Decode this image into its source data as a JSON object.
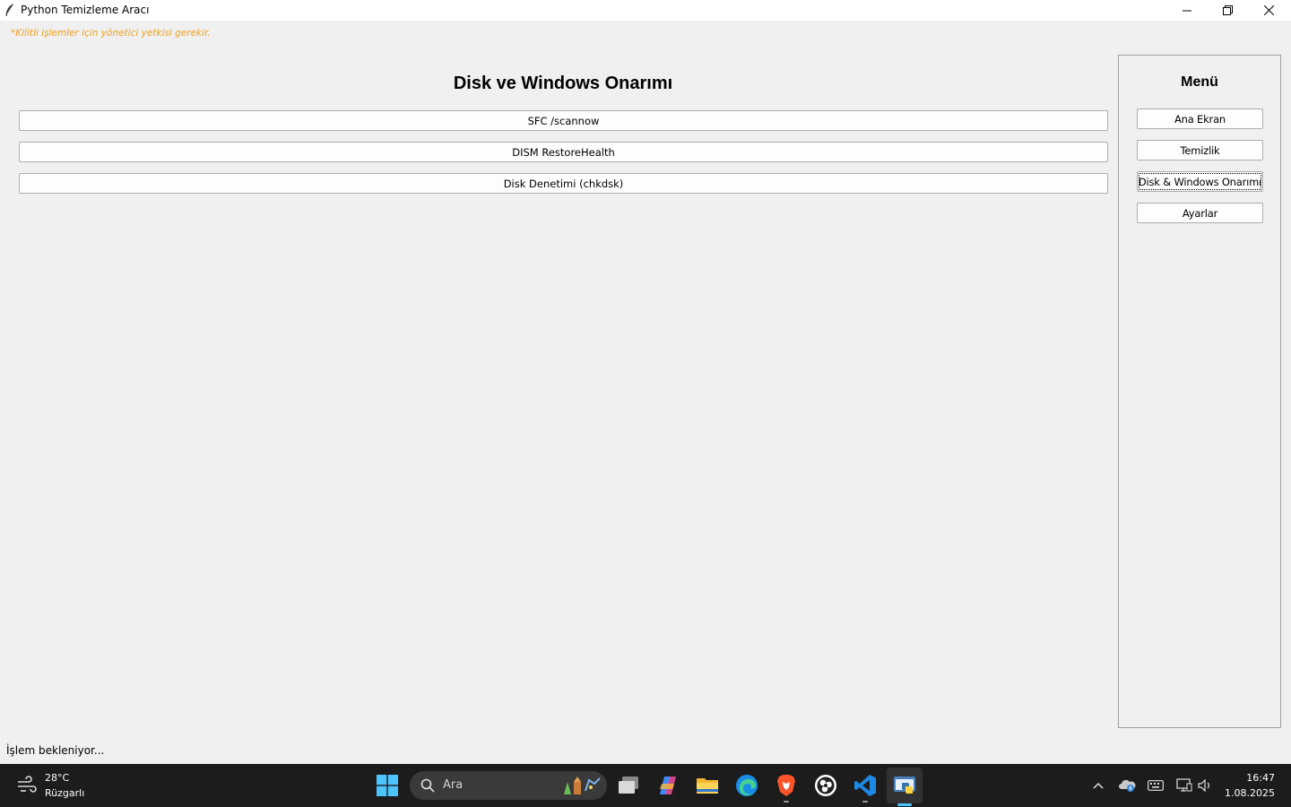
{
  "window": {
    "title": "Python Temizleme Aracı",
    "admin_warning": "*Kilitli işlemler için yönetici yetkisi gerekir."
  },
  "main": {
    "title": "Disk ve Windows Onarımı",
    "buttons": [
      {
        "label": "SFC /scannow"
      },
      {
        "label": "DISM RestoreHealth"
      },
      {
        "label": "Disk Denetimi (chkdsk)"
      }
    ]
  },
  "sidebar": {
    "title": "Menü",
    "items": [
      {
        "label": "Ana Ekran"
      },
      {
        "label": "Temizlik"
      },
      {
        "label": "Disk & Windows Onarımı",
        "selected": true
      },
      {
        "label": "Ayarlar"
      }
    ]
  },
  "status": {
    "text": "İşlem bekleniyor..."
  },
  "taskbar": {
    "weather": {
      "temp": "28°C",
      "desc": "Rüzgarlı"
    },
    "search_placeholder": "Ara",
    "apps": [
      "task-view",
      "copilot",
      "file-explorer",
      "edge",
      "brave",
      "obs",
      "vscode",
      "python"
    ],
    "clock": {
      "time": "16:47",
      "date": "1.08.2025"
    }
  },
  "colors": {
    "warning": "#f0a01c",
    "taskbar_bg": "#1c1c1c",
    "accent": "#4cc2ff",
    "window_bg": "#f0f0f0"
  }
}
